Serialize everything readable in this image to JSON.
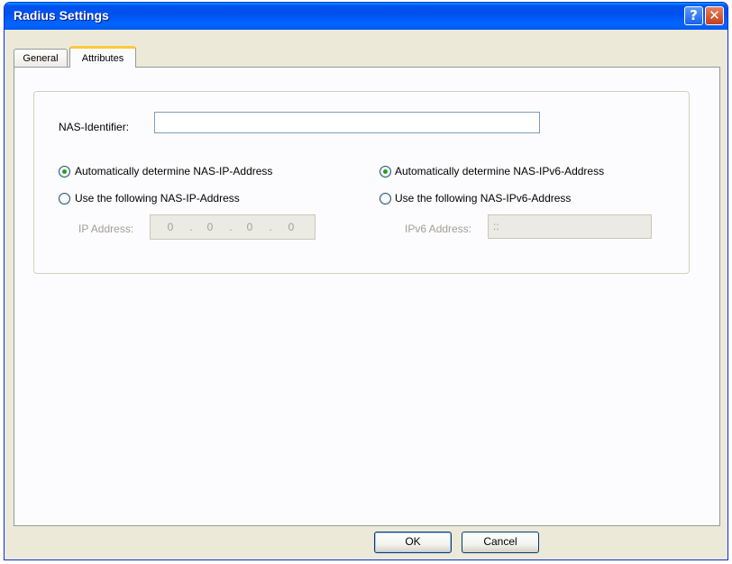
{
  "window": {
    "title": "Radius Settings",
    "help_glyph": "?",
    "close_glyph": "✕"
  },
  "tabs": [
    {
      "label": "General",
      "selected": false
    },
    {
      "label": "Attributes",
      "selected": true
    }
  ],
  "attributes": {
    "nas_identifier_label": "NAS-Identifier:",
    "nas_identifier_value": "",
    "ipv4": {
      "auto_label": "Automatically determine NAS-IP-Address",
      "auto_selected": true,
      "manual_label": "Use the following NAS-IP-Address",
      "manual_selected": false,
      "address_label": "IP Address:",
      "address_octets": [
        "0",
        "0",
        "0",
        "0"
      ]
    },
    "ipv6": {
      "auto_label": "Automatically determine NAS-IPv6-Address",
      "auto_selected": true,
      "manual_label": "Use the following NAS-IPv6-Address",
      "manual_selected": false,
      "address_label": "IPv6 Address:",
      "address_value": "::"
    }
  },
  "buttons": {
    "ok_label": "OK",
    "cancel_label": "Cancel"
  },
  "colors": {
    "titlebar": "#0053ee",
    "dialog_bg": "#ece9d8",
    "radio_selected": "#21a121",
    "active_tab_accent": "#ffc83c"
  }
}
